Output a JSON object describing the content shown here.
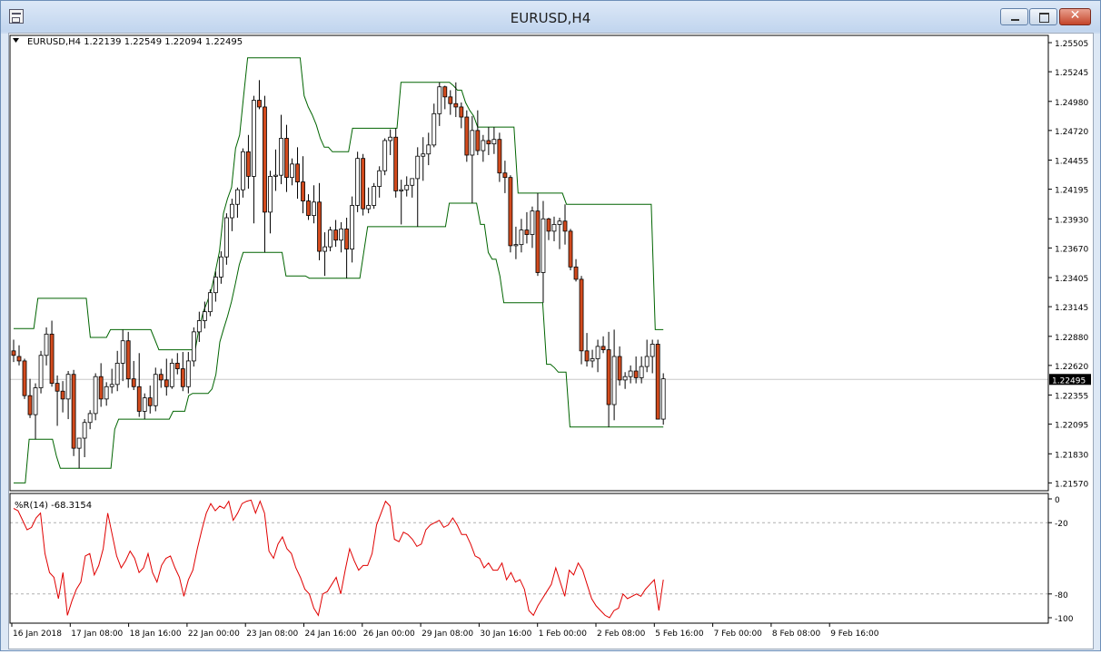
{
  "window": {
    "title": "EURUSD,H4"
  },
  "chart_data": {
    "type": "candlestick",
    "header": "EURUSD,H4  1.22139 1.22549 1.22094 1.22495",
    "current_price_label": "1.22495",
    "current_price": 1.22495,
    "price_axis_ticks": [
      "1.25505",
      "1.25245",
      "1.24980",
      "1.24720",
      "1.24455",
      "1.24195",
      "1.23930",
      "1.23670",
      "1.23405",
      "1.23145",
      "1.22880",
      "1.22620",
      "1.22355",
      "1.22095",
      "1.21830",
      "1.21570"
    ],
    "ylim": [
      1.2157,
      1.25505
    ],
    "time_axis_labels": [
      "16 Jan 2018",
      "17 Jan 08:00",
      "18 Jan 16:00",
      "22 Jan 00:00",
      "23 Jan 08:00",
      "24 Jan 16:00",
      "26 Jan 00:00",
      "29 Jan 08:00",
      "30 Jan 16:00",
      "1 Feb 00:00",
      "2 Feb 08:00",
      "5 Feb 16:00",
      "7 Feb 00:00",
      "8 Feb 08:00",
      "9 Feb 16:00"
    ],
    "candles": [
      [
        1.2275,
        1.2285,
        1.2265,
        1.2271
      ],
      [
        1.227,
        1.228,
        1.2262,
        1.2266
      ],
      [
        1.2266,
        1.2268,
        1.2232,
        1.2235
      ],
      [
        1.2235,
        1.225,
        1.2215,
        1.2218
      ],
      [
        1.2218,
        1.2246,
        1.2196,
        1.2242
      ],
      [
        1.2242,
        1.2275,
        1.2237,
        1.2271
      ],
      [
        1.2271,
        1.2296,
        1.2262,
        1.229
      ],
      [
        1.229,
        1.2302,
        1.2243,
        1.2246
      ],
      [
        1.2246,
        1.2253,
        1.2208,
        1.2239
      ],
      [
        1.2239,
        1.2248,
        1.222,
        1.2232
      ],
      [
        1.2232,
        1.2257,
        1.2214,
        1.2254
      ],
      [
        1.2254,
        1.2258,
        1.2181,
        1.2188
      ],
      [
        1.2188,
        1.219,
        1.217,
        1.2197
      ],
      [
        1.2197,
        1.2214,
        1.218,
        1.2211
      ],
      [
        1.2211,
        1.2222,
        1.2205,
        1.2219
      ],
      [
        1.2219,
        1.2255,
        1.2213,
        1.2252
      ],
      [
        1.2252,
        1.2264,
        1.2225,
        1.2232
      ],
      [
        1.2232,
        1.2247,
        1.2226,
        1.2243
      ],
      [
        1.2243,
        1.2259,
        1.2237,
        1.2245
      ],
      [
        1.2245,
        1.2275,
        1.2239,
        1.2264
      ],
      [
        1.2264,
        1.2294,
        1.2248,
        1.2284
      ],
      [
        1.2284,
        1.2292,
        1.2242,
        1.225
      ],
      [
        1.225,
        1.2266,
        1.224,
        1.2243
      ],
      [
        1.2243,
        1.2273,
        1.2216,
        1.2221
      ],
      [
        1.2221,
        1.2237,
        1.2214,
        1.2233
      ],
      [
        1.2233,
        1.2244,
        1.2219,
        1.2226
      ],
      [
        1.2226,
        1.226,
        1.2221,
        1.2254
      ],
      [
        1.2254,
        1.2259,
        1.2242,
        1.2249
      ],
      [
        1.2249,
        1.2268,
        1.2235,
        1.2243
      ],
      [
        1.2243,
        1.2268,
        1.2241,
        1.2264
      ],
      [
        1.2264,
        1.2273,
        1.2254,
        1.2259
      ],
      [
        1.2259,
        1.2274,
        1.2239,
        1.2243
      ],
      [
        1.2243,
        1.2274,
        1.2237,
        1.2266
      ],
      [
        1.2266,
        1.2296,
        1.2261,
        1.2292
      ],
      [
        1.2292,
        1.231,
        1.2283,
        1.2302
      ],
      [
        1.2302,
        1.2319,
        1.2295,
        1.231
      ],
      [
        1.231,
        1.233,
        1.2306,
        1.2327
      ],
      [
        1.2327,
        1.2346,
        1.2319,
        1.2341
      ],
      [
        1.2341,
        1.2364,
        1.2335,
        1.2359
      ],
      [
        1.2359,
        1.2398,
        1.2352,
        1.2394
      ],
      [
        1.2394,
        1.2411,
        1.2382,
        1.2406
      ],
      [
        1.2406,
        1.2421,
        1.2394,
        1.2419
      ],
      [
        1.2419,
        1.2456,
        1.2412,
        1.2453
      ],
      [
        1.2453,
        1.2468,
        1.242,
        1.2431
      ],
      [
        1.2431,
        1.2503,
        1.2389,
        1.2499
      ],
      [
        1.2499,
        1.2517,
        1.2491,
        1.2493
      ],
      [
        1.2493,
        1.2503,
        1.2363,
        1.2399
      ],
      [
        1.2399,
        1.2436,
        1.238,
        1.2431
      ],
      [
        1.2431,
        1.2455,
        1.2418,
        1.2432
      ],
      [
        1.2432,
        1.2486,
        1.2424,
        1.2465
      ],
      [
        1.2465,
        1.2477,
        1.2417,
        1.243
      ],
      [
        1.243,
        1.2447,
        1.2423,
        1.2442
      ],
      [
        1.2442,
        1.2457,
        1.2411,
        1.2426
      ],
      [
        1.2426,
        1.2449,
        1.2398,
        1.2409
      ],
      [
        1.2409,
        1.2415,
        1.2392,
        1.2396
      ],
      [
        1.2396,
        1.2423,
        1.2389,
        1.2408
      ],
      [
        1.2408,
        1.2425,
        1.2356,
        1.2364
      ],
      [
        1.2364,
        1.2381,
        1.2342,
        1.2368
      ],
      [
        1.2368,
        1.2386,
        1.2364,
        1.2383
      ],
      [
        1.2383,
        1.2392,
        1.2368,
        1.2374
      ],
      [
        1.2374,
        1.239,
        1.2363,
        1.2384
      ],
      [
        1.2384,
        1.2394,
        1.234,
        1.2366
      ],
      [
        1.2366,
        1.2413,
        1.2354,
        1.2405
      ],
      [
        1.2405,
        1.2453,
        1.2399,
        1.2447
      ],
      [
        1.2447,
        1.2451,
        1.2396,
        1.2402
      ],
      [
        1.2402,
        1.2421,
        1.2398,
        1.2405
      ],
      [
        1.2405,
        1.2425,
        1.2402,
        1.2422
      ],
      [
        1.2422,
        1.244,
        1.2412,
        1.2436
      ],
      [
        1.2436,
        1.2465,
        1.2432,
        1.2463
      ],
      [
        1.2463,
        1.2473,
        1.245,
        1.2466
      ],
      [
        1.2466,
        1.2474,
        1.2412,
        1.2418
      ],
      [
        1.2418,
        1.2428,
        1.2388,
        1.2419
      ],
      [
        1.2419,
        1.2431,
        1.2413,
        1.2423
      ],
      [
        1.2423,
        1.2429,
        1.2412,
        1.2429
      ],
      [
        1.2429,
        1.2457,
        1.2386,
        1.2449
      ],
      [
        1.2449,
        1.2466,
        1.2427,
        1.2451
      ],
      [
        1.2451,
        1.247,
        1.2441,
        1.2459
      ],
      [
        1.2459,
        1.2496,
        1.2457,
        1.2487
      ],
      [
        1.2487,
        1.2515,
        1.2476,
        1.2511
      ],
      [
        1.2511,
        1.2512,
        1.2491,
        1.2502
      ],
      [
        1.2502,
        1.2508,
        1.2486,
        1.2496
      ],
      [
        1.2496,
        1.2515,
        1.2484,
        1.2493
      ],
      [
        1.2493,
        1.2497,
        1.2474,
        1.2484
      ],
      [
        1.2484,
        1.249,
        1.2444,
        1.245
      ],
      [
        1.245,
        1.2485,
        1.2407,
        1.2472
      ],
      [
        1.2472,
        1.249,
        1.245,
        1.2454
      ],
      [
        1.2454,
        1.2468,
        1.2444,
        1.2463
      ],
      [
        1.2463,
        1.2475,
        1.245,
        1.246
      ],
      [
        1.246,
        1.2475,
        1.2451,
        1.2464
      ],
      [
        1.2464,
        1.247,
        1.2426,
        1.2434
      ],
      [
        1.2434,
        1.2445,
        1.2416,
        1.243
      ],
      [
        1.243,
        1.2432,
        1.2363,
        1.2369
      ],
      [
        1.2369,
        1.2386,
        1.2357,
        1.237
      ],
      [
        1.237,
        1.2393,
        1.2363,
        1.2383
      ],
      [
        1.2383,
        1.2399,
        1.2371,
        1.2379
      ],
      [
        1.2379,
        1.2404,
        1.2367,
        1.24
      ],
      [
        1.24,
        1.2416,
        1.2342,
        1.2345
      ],
      [
        1.2345,
        1.2409,
        1.2318,
        1.2393
      ],
      [
        1.2393,
        1.2394,
        1.2374,
        1.2382
      ],
      [
        1.2382,
        1.2395,
        1.2373,
        1.2388
      ],
      [
        1.2388,
        1.2394,
        1.2366,
        1.2391
      ],
      [
        1.2391,
        1.2406,
        1.237,
        1.2382
      ],
      [
        1.2382,
        1.2384,
        1.2347,
        1.235
      ],
      [
        1.235,
        1.2357,
        1.2337,
        1.2339
      ],
      [
        1.2339,
        1.2342,
        1.2263,
        1.2275
      ],
      [
        1.2275,
        1.2291,
        1.2261,
        1.2266
      ],
      [
        1.2266,
        1.2276,
        1.226,
        1.2268
      ],
      [
        1.2268,
        1.2285,
        1.2256,
        1.2279
      ],
      [
        1.2279,
        1.2288,
        1.2273,
        1.2276
      ],
      [
        1.2276,
        1.2292,
        1.2207,
        1.2227
      ],
      [
        1.2227,
        1.2294,
        1.2213,
        1.227
      ],
      [
        1.227,
        1.2279,
        1.2244,
        1.2249
      ],
      [
        1.2249,
        1.2256,
        1.2241,
        1.2252
      ],
      [
        1.2252,
        1.2262,
        1.2246,
        1.2257
      ],
      [
        1.2257,
        1.227,
        1.2246,
        1.2251
      ],
      [
        1.2251,
        1.227,
        1.2246,
        1.2261
      ],
      [
        1.2261,
        1.2285,
        1.2256,
        1.227
      ],
      [
        1.227,
        1.2285,
        1.2255,
        1.2281
      ],
      [
        1.2281,
        1.2285,
        1.2231,
        1.2214
      ],
      [
        1.2214,
        1.2255,
        1.2209,
        1.225
      ]
    ],
    "donchian_upper": [
      1.2295,
      1.2295,
      1.2295,
      1.2295,
      1.2295,
      1.2295,
      1.2322,
      1.2322,
      1.2322,
      1.2322,
      1.2322,
      1.2322,
      1.2322,
      1.2322,
      1.2322,
      1.2322,
      1.2322,
      1.2322,
      1.2322,
      1.2287,
      1.2287,
      1.2287,
      1.2287,
      1.2287,
      1.2294,
      1.2294,
      1.2294,
      1.2294,
      1.2294,
      1.2294,
      1.2294,
      1.2294,
      1.2294,
      1.2294,
      1.2294,
      1.2285,
      1.2276,
      1.2276,
      1.2276,
      1.2276,
      1.2276,
      1.2276,
      1.2276,
      1.2276,
      1.2276,
      1.2276,
      1.2296,
      1.231,
      1.2319,
      1.233,
      1.2346,
      1.2364,
      1.2398,
      1.2411,
      1.2421,
      1.2456,
      1.2468,
      1.2503,
      1.2537,
      1.2537,
      1.2537,
      1.2537,
      1.2537,
      1.2537,
      1.2537,
      1.2537,
      1.2537,
      1.2537,
      1.2537,
      1.2537,
      1.2537,
      1.2537,
      1.2503,
      1.2493,
      1.2486,
      1.2477,
      1.2465,
      1.2457,
      1.2457,
      1.2453,
      1.2453,
      1.2453,
      1.2453,
      1.2453,
      1.2474,
      1.2474,
      1.2474,
      1.2474,
      1.2474,
      1.2474,
      1.2474,
      1.2474,
      1.2474,
      1.2474,
      1.2474,
      1.2474,
      1.2515,
      1.2515,
      1.2515,
      1.2515,
      1.2515,
      1.2515,
      1.2515,
      1.2515,
      1.2515,
      1.2515,
      1.2515,
      1.2515,
      1.2515,
      1.2512,
      1.2508,
      1.2508,
      1.2497,
      1.249,
      1.2485,
      1.2475,
      1.2475,
      1.2475,
      1.2475,
      1.2475,
      1.2475,
      1.2475,
      1.2475,
      1.2475,
      1.2475,
      1.2416,
      1.2416,
      1.2416,
      1.2416,
      1.2416,
      1.2416,
      1.2416,
      1.2416,
      1.2416,
      1.2416,
      1.2416,
      1.2416,
      1.2406,
      1.2406,
      1.2406,
      1.2406,
      1.2406,
      1.2406,
      1.2406,
      1.2406,
      1.2406,
      1.2406,
      1.2406,
      1.2406,
      1.2406,
      1.2406,
      1.2406,
      1.2406,
      1.2406,
      1.2406,
      1.2406,
      1.2406,
      1.2406,
      1.2406,
      1.2294,
      1.2294,
      1.2294
    ],
    "donchian_lower": [
      1.2157,
      1.2157,
      1.2157,
      1.2157,
      1.2196,
      1.2196,
      1.2196,
      1.2196,
      1.2196,
      1.2196,
      1.2196,
      1.2181,
      1.217,
      1.217,
      1.217,
      1.217,
      1.217,
      1.217,
      1.217,
      1.217,
      1.217,
      1.217,
      1.217,
      1.217,
      1.217,
      1.217,
      1.2205,
      1.2214,
      1.2214,
      1.2214,
      1.2214,
      1.2214,
      1.2214,
      1.2214,
      1.2214,
      1.2214,
      1.2214,
      1.2214,
      1.2214,
      1.2214,
      1.2214,
      1.2221,
      1.2221,
      1.2221,
      1.2221,
      1.2235,
      1.2237,
      1.2237,
      1.2237,
      1.2237,
      1.2237,
      1.2241,
      1.2254,
      1.2283,
      1.2295,
      1.2306,
      1.2319,
      1.2335,
      1.2352,
      1.2363,
      1.2363,
      1.2363,
      1.2363,
      1.2363,
      1.2363,
      1.2363,
      1.2363,
      1.2363,
      1.2363,
      1.2363,
      1.2342,
      1.2342,
      1.2342,
      1.2342,
      1.2342,
      1.2342,
      1.234,
      1.234,
      1.234,
      1.234,
      1.234,
      1.234,
      1.234,
      1.234,
      1.234,
      1.234,
      1.234,
      1.234,
      1.234,
      1.234,
      1.2363,
      1.2386,
      1.2386,
      1.2386,
      1.2386,
      1.2386,
      1.2386,
      1.2386,
      1.2386,
      1.2386,
      1.2386,
      1.2386,
      1.2386,
      1.2386,
      1.2386,
      1.2386,
      1.2386,
      1.2386,
      1.2386,
      1.2386,
      1.2386,
      1.2386,
      1.2407,
      1.2407,
      1.2407,
      1.2407,
      1.2407,
      1.2407,
      1.2407,
      1.2407,
      1.2388,
      1.2388,
      1.2363,
      1.2357,
      1.2357,
      1.2342,
      1.2318,
      1.2318,
      1.2318,
      1.2318,
      1.2318,
      1.2318,
      1.2318,
      1.2318,
      1.2318,
      1.2318,
      1.2318,
      1.2263,
      1.2263,
      1.226,
      1.2256,
      1.2256,
      1.2256,
      1.2207,
      1.2207,
      1.2207,
      1.2207,
      1.2207,
      1.2207,
      1.2207,
      1.2207,
      1.2207,
      1.2207,
      1.2207,
      1.2207,
      1.2207,
      1.2207,
      1.2207,
      1.2207,
      1.2207,
      1.2207,
      1.2207,
      1.2207,
      1.2207,
      1.2207,
      1.2207,
      1.2207,
      1.2207
    ],
    "indicator": {
      "label": "%R(14) -68.3154",
      "name": "%R(14)",
      "last_value": -68.3154,
      "axis_ticks": [
        "0",
        "-20",
        "-80",
        "-100"
      ],
      "ylim": [
        -100,
        0
      ],
      "levels": [
        -20,
        -80
      ],
      "values": [
        -8,
        -10,
        -18,
        -26,
        -24,
        -16,
        -12,
        -46,
        -62,
        -66,
        -84,
        -62,
        -98,
        -86,
        -76,
        -70,
        -48,
        -46,
        -64,
        -56,
        -42,
        -12,
        -30,
        -48,
        -58,
        -52,
        -44,
        -50,
        -62,
        -58,
        -46,
        -62,
        -70,
        -56,
        -50,
        -48,
        -58,
        -66,
        -82,
        -68,
        -60,
        -42,
        -26,
        -12,
        -4,
        -10,
        -6,
        -8,
        -2,
        -18,
        -12,
        -4,
        -2,
        -1,
        -12,
        -2,
        -12,
        -44,
        -50,
        -38,
        -32,
        -42,
        -46,
        -58,
        -66,
        -76,
        -80,
        -92,
        -98,
        -80,
        -78,
        -72,
        -66,
        -80,
        -60,
        -42,
        -52,
        -60,
        -56,
        -56,
        -46,
        -22,
        -12,
        -2,
        -6,
        -34,
        -36,
        -28,
        -30,
        -34,
        -40,
        -38,
        -26,
        -22,
        -20,
        -18,
        -24,
        -22,
        -16,
        -22,
        -30,
        -30,
        -38,
        -48,
        -50,
        -58,
        -54,
        -60,
        -60,
        -54,
        -68,
        -62,
        -70,
        -68,
        -76,
        -94,
        -98,
        -90,
        -84,
        -78,
        -72,
        -58,
        -70,
        -82,
        -60,
        -64,
        -54,
        -60,
        -72,
        -84,
        -90,
        -94,
        -98,
        -100,
        -94,
        -92,
        -80,
        -84,
        -82,
        -80,
        -82,
        -76,
        -72,
        -68,
        -94,
        -68
      ]
    }
  }
}
